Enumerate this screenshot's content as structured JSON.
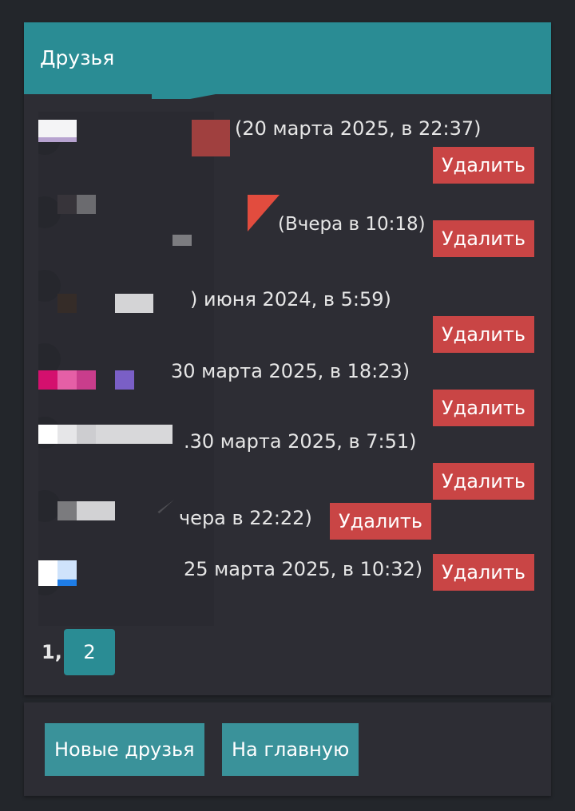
{
  "panel": {
    "title": "Друзья"
  },
  "friends": [
    {
      "date": "(20 марта 2025, в 22:37)",
      "delete_label": "Удалить"
    },
    {
      "date": "(Вчера в 10:18)",
      "delete_label": "Удалить"
    },
    {
      "date": ") июня 2024, в 5:59)",
      "delete_label": "Удалить"
    },
    {
      "date": "30 марта 2025, в 18:23)",
      "delete_label": "Удалить"
    },
    {
      "date": ".30 марта 2025, в 7:51)",
      "delete_label": "Удалить"
    },
    {
      "date": "чера в 22:22)",
      "delete_label": "Удалить"
    },
    {
      "date": "25 марта 2025, в 10:32)",
      "delete_label": "Удалить"
    }
  ],
  "pagination": {
    "current": "1,",
    "next": "2"
  },
  "nav": {
    "new_friends_label": "Новые друзья",
    "home_label": "На главную"
  },
  "colors": {
    "header": "#2a8c94",
    "danger": "#c94545",
    "button": "#3a929a",
    "background": "#23262b",
    "panel": "#2d2d34"
  }
}
